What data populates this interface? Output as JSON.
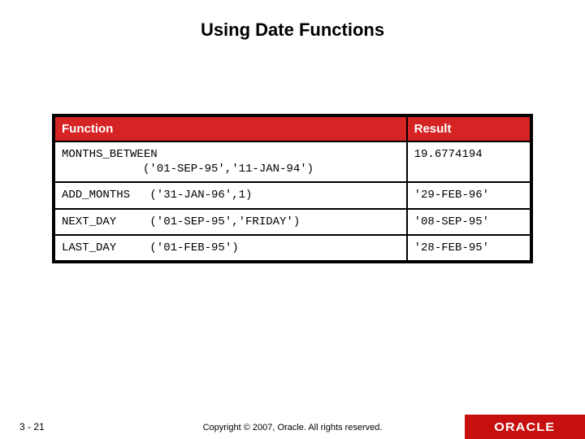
{
  "title": "Using Date Functions",
  "table": {
    "headers": {
      "function": "Function",
      "result": "Result"
    },
    "rows": [
      {
        "fn_name": "MONTHS_BETWEEN",
        "fn_args": "('01-SEP-95','11-JAN-94')",
        "result": "19.6774194",
        "indented": true
      },
      {
        "fn_name": "ADD_MONTHS",
        "fn_args": "('31-JAN-96',1)",
        "result": "'29-FEB-96'",
        "indented": false
      },
      {
        "fn_name": "NEXT_DAY",
        "fn_args": "('01-SEP-95','FRIDAY')",
        "result": "'08-SEP-95'",
        "indented": false
      },
      {
        "fn_name": "LAST_DAY",
        "fn_args": "('01-FEB-95')",
        "result": "'28-FEB-95'",
        "indented": false
      }
    ]
  },
  "footer": {
    "page": "3 - 21",
    "copyright": "Copyright © 2007, Oracle. All rights reserved.",
    "logo_text": "ORACLE"
  }
}
